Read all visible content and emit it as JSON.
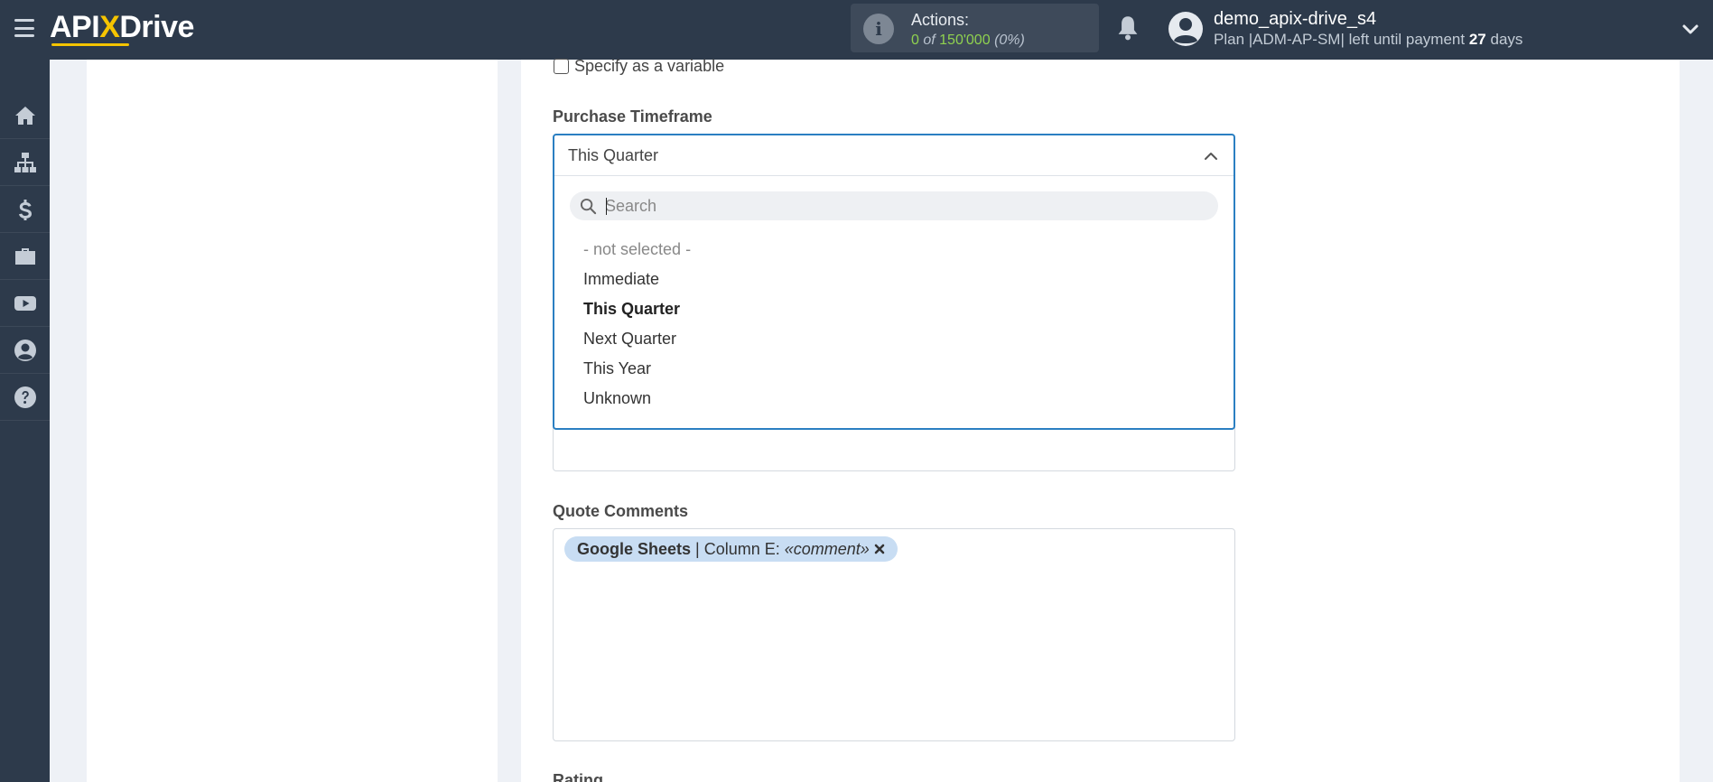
{
  "header": {
    "logo_prefix": "API",
    "logo_x": "X",
    "logo_suffix": "Drive",
    "actions": {
      "label": "Actions:",
      "used": "0",
      "of": "of",
      "total": "150'000",
      "percent": "(0%)"
    },
    "user": {
      "name": "demo_apix-drive_s4",
      "plan_prefix": "Plan |ADM-AP-SM| left until payment",
      "days_value": "27",
      "days_unit": "days"
    }
  },
  "sidebar": {
    "items": [
      {
        "icon": "home-icon"
      },
      {
        "icon": "sitemap-icon"
      },
      {
        "icon": "dollar-icon"
      },
      {
        "icon": "briefcase-icon"
      },
      {
        "icon": "youtube-icon"
      },
      {
        "icon": "user-circle-icon"
      },
      {
        "icon": "help-icon"
      }
    ]
  },
  "form": {
    "variable_checkbox_label": "Specify as a variable",
    "purchase_timeframe": {
      "label": "Purchase Timeframe",
      "selected": "This Quarter",
      "search_placeholder": "Search",
      "options": [
        "- not selected -",
        "Immediate",
        "This Quarter",
        "Next Quarter",
        "This Year",
        "Unknown"
      ]
    },
    "quote_comments": {
      "label": "Quote Comments",
      "tag_source": "Google Sheets",
      "tag_separator": "|",
      "tag_column": "Column E:",
      "tag_value": "«comment»"
    },
    "rating_label": "Rating"
  },
  "colors": {
    "topbar": "#2d3a4b",
    "accent_yellow": "#f5c400",
    "focus_border": "#2b7fc2",
    "tag_bg": "#c8ddf3",
    "actions_green": "#8fd14f"
  }
}
